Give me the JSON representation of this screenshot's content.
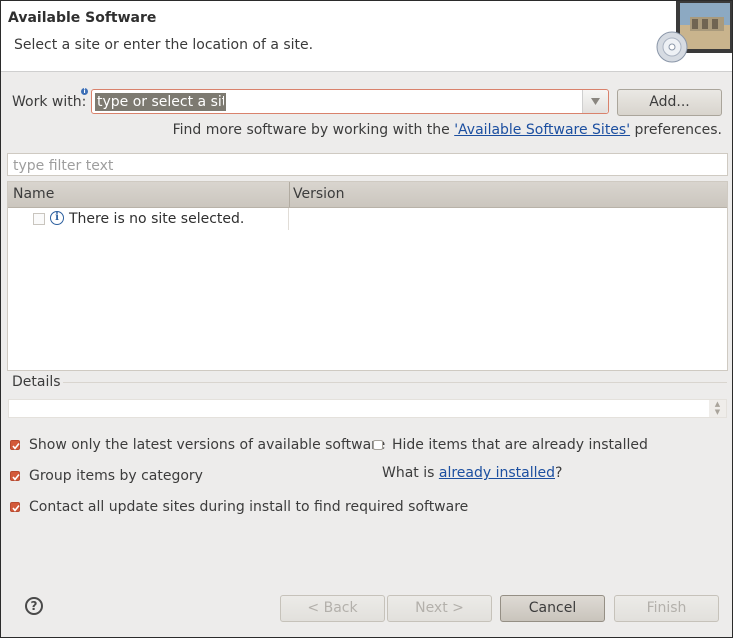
{
  "header": {
    "title": "Available Software",
    "description": "Select a site or enter the location of a site."
  },
  "work_with": {
    "label": "Work with:",
    "placeholder": "type or select a site",
    "add_button": "Add...",
    "find_more_prefix": "Find more software by working with the ",
    "find_more_link": "'Available Software Sites'",
    "find_more_suffix": " preferences."
  },
  "filter": {
    "placeholder": "type filter text"
  },
  "table": {
    "columns": [
      "Name",
      "Version"
    ],
    "rows": [
      {
        "name": "There is no site selected.",
        "version": ""
      }
    ]
  },
  "details": {
    "label": "Details"
  },
  "options": {
    "show_latest": {
      "label": "Show only the latest versions of available software",
      "checked": true
    },
    "hide_installed": {
      "label": "Hide items that are already installed",
      "checked": false
    },
    "group_by_category": {
      "label": "Group items by category",
      "checked": true
    },
    "what_is_prefix": "What is ",
    "what_is_link": "already installed",
    "what_is_suffix": "?",
    "contact_all_sites": {
      "label": "Contact all update sites during install to find required software",
      "checked": true
    }
  },
  "buttons": {
    "help": "?",
    "back": "< Back",
    "next": "Next >",
    "cancel": "Cancel",
    "finish": "Finish"
  },
  "colors": {
    "accent": "#d35a3a",
    "link": "#1c4fa0"
  }
}
